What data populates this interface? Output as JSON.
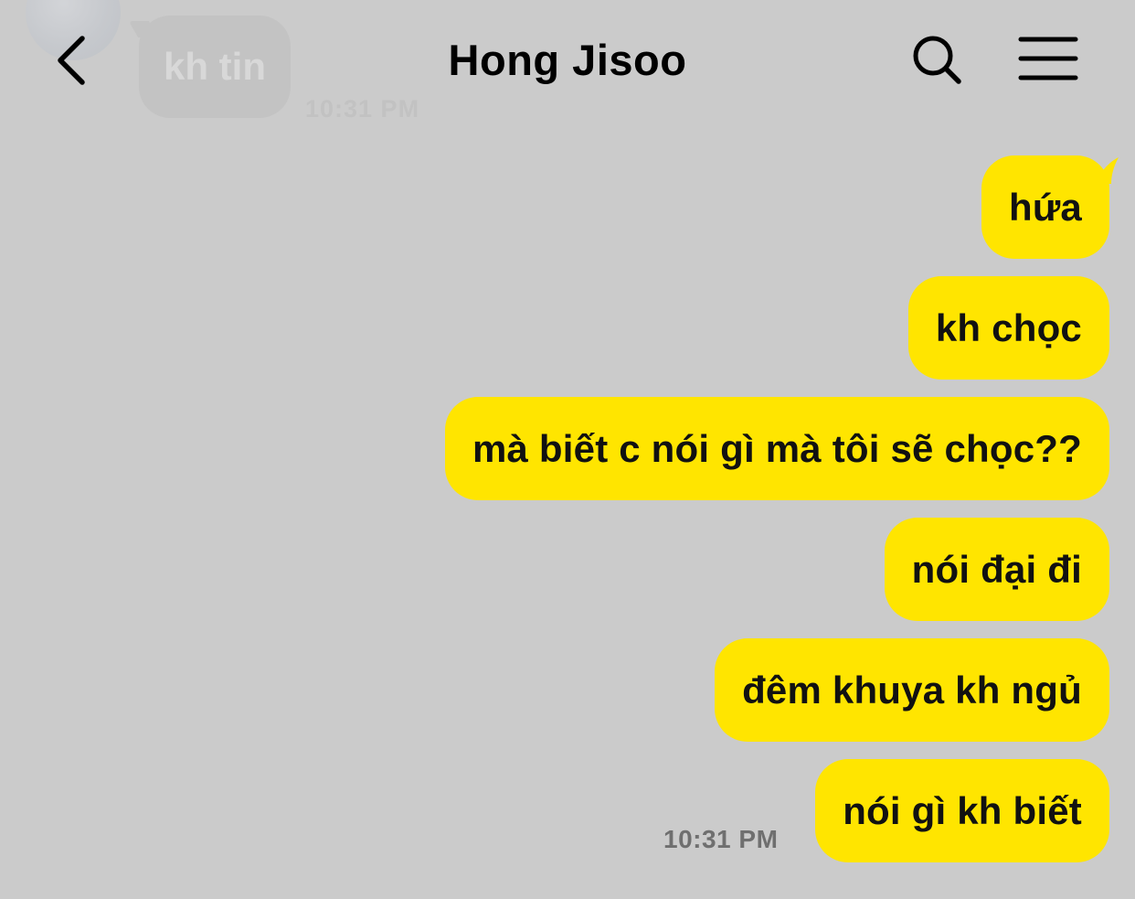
{
  "header": {
    "title": "Hong Jisoo",
    "back_icon": "chevron-left-icon",
    "search_icon": "search-icon",
    "menu_icon": "hamburger-menu-icon"
  },
  "previous_message": {
    "text": "kh tin",
    "time": "10:31 PM"
  },
  "messages": [
    {
      "text": "hứa",
      "sender": "me"
    },
    {
      "text": "kh chọc",
      "sender": "me"
    },
    {
      "text": "mà biết c nói gì mà tôi sẽ chọc??",
      "sender": "me"
    },
    {
      "text": "nói đại đi",
      "sender": "me"
    },
    {
      "text": "đêm khuya kh ngủ",
      "sender": "me"
    },
    {
      "text": "nói gì kh biết",
      "sender": "me"
    }
  ],
  "last_message_time": "10:31 PM",
  "colors": {
    "background": "#cbcbcb",
    "my_bubble": "#ffe500",
    "text": "#111111",
    "timestamp": "#6f6f6f"
  }
}
